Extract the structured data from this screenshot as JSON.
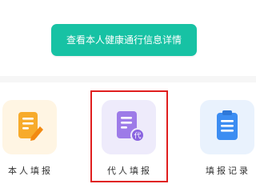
{
  "health_pass_button": {
    "label": "查看本人健康通行信息详情"
  },
  "actions": [
    {
      "label": "本人填报",
      "icon": "edit-document-icon",
      "tile_color": "#fff5e3",
      "icon_color": "#f7ab2c"
    },
    {
      "label": "代人填报",
      "icon": "proxy-document-icon",
      "tile_color": "#eeebfb",
      "icon_color": "#9d7be8"
    },
    {
      "label": "填报记录",
      "icon": "clipboard-list-icon",
      "tile_color": "#e9f2fd",
      "icon_color": "#3c8df2"
    }
  ],
  "proxy_badge": "代",
  "colors": {
    "accent": "#17c2a4",
    "highlight": "#e01e1e"
  }
}
